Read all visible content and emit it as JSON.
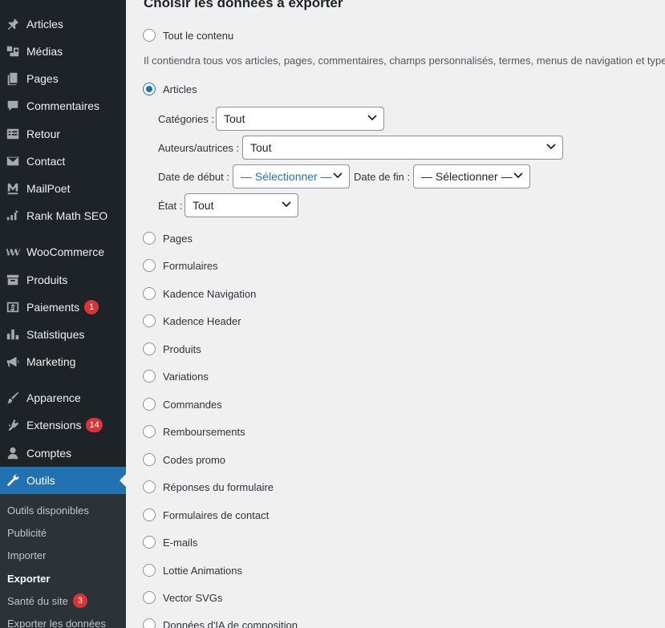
{
  "sidebar": {
    "items": [
      {
        "label": "Articles",
        "icon": "pin-icon"
      },
      {
        "label": "Médias",
        "icon": "media-icon"
      },
      {
        "label": "Pages",
        "icon": "pages-icon"
      },
      {
        "label": "Commentaires",
        "icon": "comments-icon"
      },
      {
        "label": "Retour",
        "icon": "feedback-icon"
      },
      {
        "label": "Contact",
        "icon": "envelope-icon"
      },
      {
        "label": "MailPoet",
        "icon": "mailpoet-icon"
      },
      {
        "label": "Rank Math SEO",
        "icon": "rankmath-icon"
      },
      {
        "label": "WooCommerce",
        "icon": "woocommerce-icon"
      },
      {
        "label": "Produits",
        "icon": "archive-icon"
      },
      {
        "label": "Paiements",
        "icon": "payments-icon",
        "badge": "1"
      },
      {
        "label": "Statistiques",
        "icon": "bar-chart-icon"
      },
      {
        "label": "Marketing",
        "icon": "megaphone-icon"
      },
      {
        "label": "Apparence",
        "icon": "brush-icon"
      },
      {
        "label": "Extensions",
        "icon": "plugin-icon",
        "badge": "14"
      },
      {
        "label": "Comptes",
        "icon": "user-icon"
      },
      {
        "label": "Outils",
        "icon": "wrench-icon",
        "current": true
      }
    ],
    "submenu": [
      {
        "label": "Outils disponibles"
      },
      {
        "label": "Publicité"
      },
      {
        "label": "Importer"
      },
      {
        "label": "Exporter",
        "current": true
      },
      {
        "label": "Santé du site",
        "badge": "3"
      },
      {
        "label": "Exporter les données"
      }
    ]
  },
  "main": {
    "title": "Choisir les données à exporter",
    "all_content_label": "Tout le contenu",
    "all_content_description": "Il contiendra tous vos articles, pages, commentaires, champs personnalisés, termes, menus de navigation et types",
    "articles_label": "Articles",
    "filters": {
      "categories_label": "Catégories :",
      "categories_value": "Tout",
      "authors_label": "Auteurs/autrices :",
      "authors_value": "Tout",
      "start_date_label": "Date de début :",
      "start_date_value": "— Sélectionner —",
      "end_date_label": "Date de fin :",
      "end_date_value": "— Sélectionner —",
      "status_label": "État :",
      "status_value": "Tout"
    },
    "other_types": [
      "Pages",
      "Formulaires",
      "Kadence Navigation",
      "Kadence Header",
      "Produits",
      "Variations",
      "Commandes",
      "Remboursements",
      "Codes promo",
      "Réponses du formulaire",
      "Formulaires de contact",
      "E-mails",
      "Lottie Animations",
      "Vector SVGs",
      "Données d'IA de composition"
    ]
  },
  "colors": {
    "sidebar_bg": "#1d2327",
    "submenu_bg": "#2c3338",
    "accent": "#2271b1",
    "badge": "#d63638",
    "page_bg": "#f0f0f1"
  }
}
